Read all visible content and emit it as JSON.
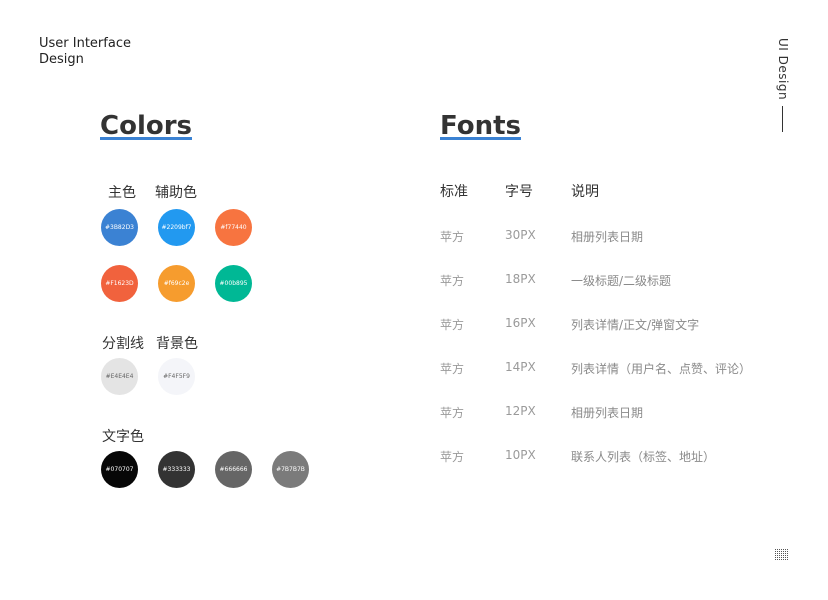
{
  "brand": {
    "line1": "User Interface",
    "line2": "Design"
  },
  "side_label": "UI Design",
  "colors": {
    "title": "Colors",
    "primary_label": "主色",
    "secondary_label": "辅助色",
    "row1": [
      {
        "hex": "#3B82D3",
        "color": "#3B82D3"
      },
      {
        "hex": "#2209bf7",
        "color": "#2299F0"
      },
      {
        "hex": "#f77440",
        "color": "#F77440"
      }
    ],
    "row2": [
      {
        "hex": "#F1623D",
        "color": "#F1623D"
      },
      {
        "hex": "#f69c2e",
        "color": "#F69C2E"
      },
      {
        "hex": "#00b895",
        "color": "#00B895"
      }
    ],
    "divider_label": "分割线",
    "background_label": "背景色",
    "row3": [
      {
        "hex": "#E4E4E4",
        "color": "#E4E4E4"
      },
      {
        "hex": "#F4F5F9",
        "color": "#F4F5F9"
      }
    ],
    "text_label": "文字色",
    "row4": [
      {
        "hex": "#070707",
        "color": "#070707"
      },
      {
        "hex": "#333333",
        "color": "#333333"
      },
      {
        "hex": "#666666",
        "color": "#666666"
      },
      {
        "hex": "#7B7B7B",
        "color": "#7B7B7B"
      }
    ]
  },
  "fonts": {
    "title": "Fonts",
    "headers": {
      "standard": "标准",
      "size": "字号",
      "description": "说明"
    },
    "rows": [
      {
        "font": "苹方",
        "size": "30PX",
        "desc": "相册列表日期"
      },
      {
        "font": "苹方",
        "size": "18PX",
        "desc": "一级标题/二级标题"
      },
      {
        "font": "苹方",
        "size": "16PX",
        "desc": "列表详情/正文/弹窗文字"
      },
      {
        "font": "苹方",
        "size": "14PX",
        "desc": "列表详情（用户名、点赞、评论）"
      },
      {
        "font": "苹方",
        "size": "12PX",
        "desc": "相册列表日期"
      },
      {
        "font": "苹方",
        "size": "10PX",
        "desc": "联系人列表（标签、地址）"
      }
    ]
  },
  "accent_color": "#3B82D3",
  "icons": {
    "corner": "dot-grid-icon"
  }
}
